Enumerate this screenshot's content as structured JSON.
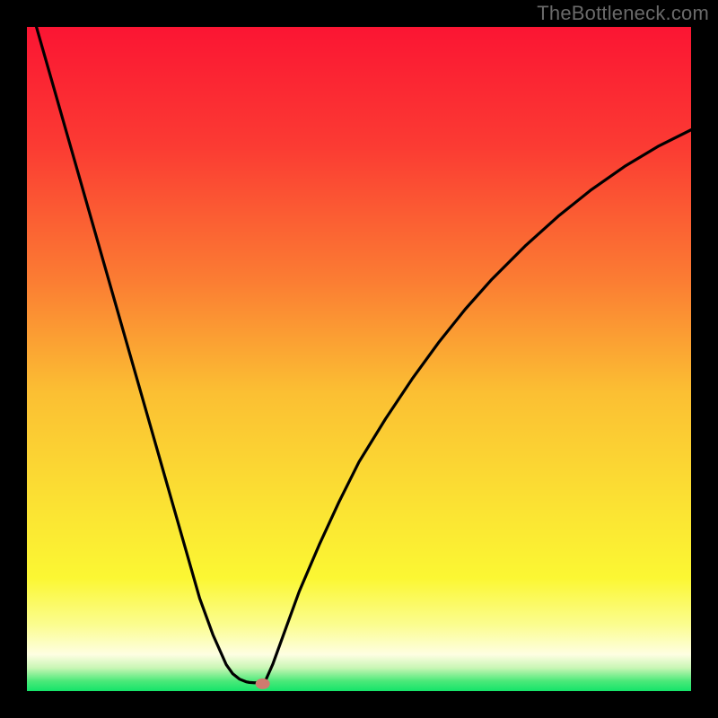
{
  "watermark": "TheBottleneck.com",
  "colors": {
    "page_bg": "#000000",
    "curve": "#000000",
    "marker": "#cf7b6f",
    "watermark": "#6a6a6a"
  },
  "chart_data": {
    "type": "line",
    "title": "",
    "xlabel": "",
    "ylabel": "",
    "xlim": [
      0,
      100
    ],
    "ylim": [
      0,
      100
    ],
    "gradient_stops": [
      {
        "offset": 0.0,
        "color": "#fb1533"
      },
      {
        "offset": 0.18,
        "color": "#fb3b33"
      },
      {
        "offset": 0.38,
        "color": "#fb7c33"
      },
      {
        "offset": 0.55,
        "color": "#fbbf33"
      },
      {
        "offset": 0.72,
        "color": "#fbe233"
      },
      {
        "offset": 0.83,
        "color": "#fbf733"
      },
      {
        "offset": 0.9,
        "color": "#fbfd8f"
      },
      {
        "offset": 0.945,
        "color": "#fefee2"
      },
      {
        "offset": 0.965,
        "color": "#c9f6b5"
      },
      {
        "offset": 0.985,
        "color": "#4be979"
      },
      {
        "offset": 1.0,
        "color": "#15e46a"
      }
    ],
    "left_branch": {
      "x": [
        0,
        2,
        4,
        6,
        8,
        10,
        12,
        14,
        16,
        18,
        20,
        22,
        24,
        26,
        28,
        30,
        31,
        32,
        33,
        33.5
      ],
      "y": [
        105,
        98,
        91,
        84,
        77,
        70,
        63,
        56,
        49,
        42,
        35,
        28,
        21,
        14,
        8.5,
        4.0,
        2.6,
        1.8,
        1.4,
        1.3
      ]
    },
    "flat_segment": {
      "x": [
        33.5,
        34.2,
        35.0,
        35.8
      ],
      "y": [
        1.3,
        1.25,
        1.25,
        1.3
      ]
    },
    "right_branch": {
      "x": [
        35.8,
        37,
        39,
        41,
        44,
        47,
        50,
        54,
        58,
        62,
        66,
        70,
        75,
        80,
        85,
        90,
        95,
        100
      ],
      "y": [
        1.3,
        4.0,
        9.5,
        15.0,
        22.0,
        28.5,
        34.5,
        41.0,
        47.0,
        52.5,
        57.5,
        62.0,
        67.0,
        71.5,
        75.5,
        79.0,
        82.0,
        84.5
      ]
    },
    "optimal_point": {
      "x": 35.5,
      "y": 1.1
    }
  }
}
